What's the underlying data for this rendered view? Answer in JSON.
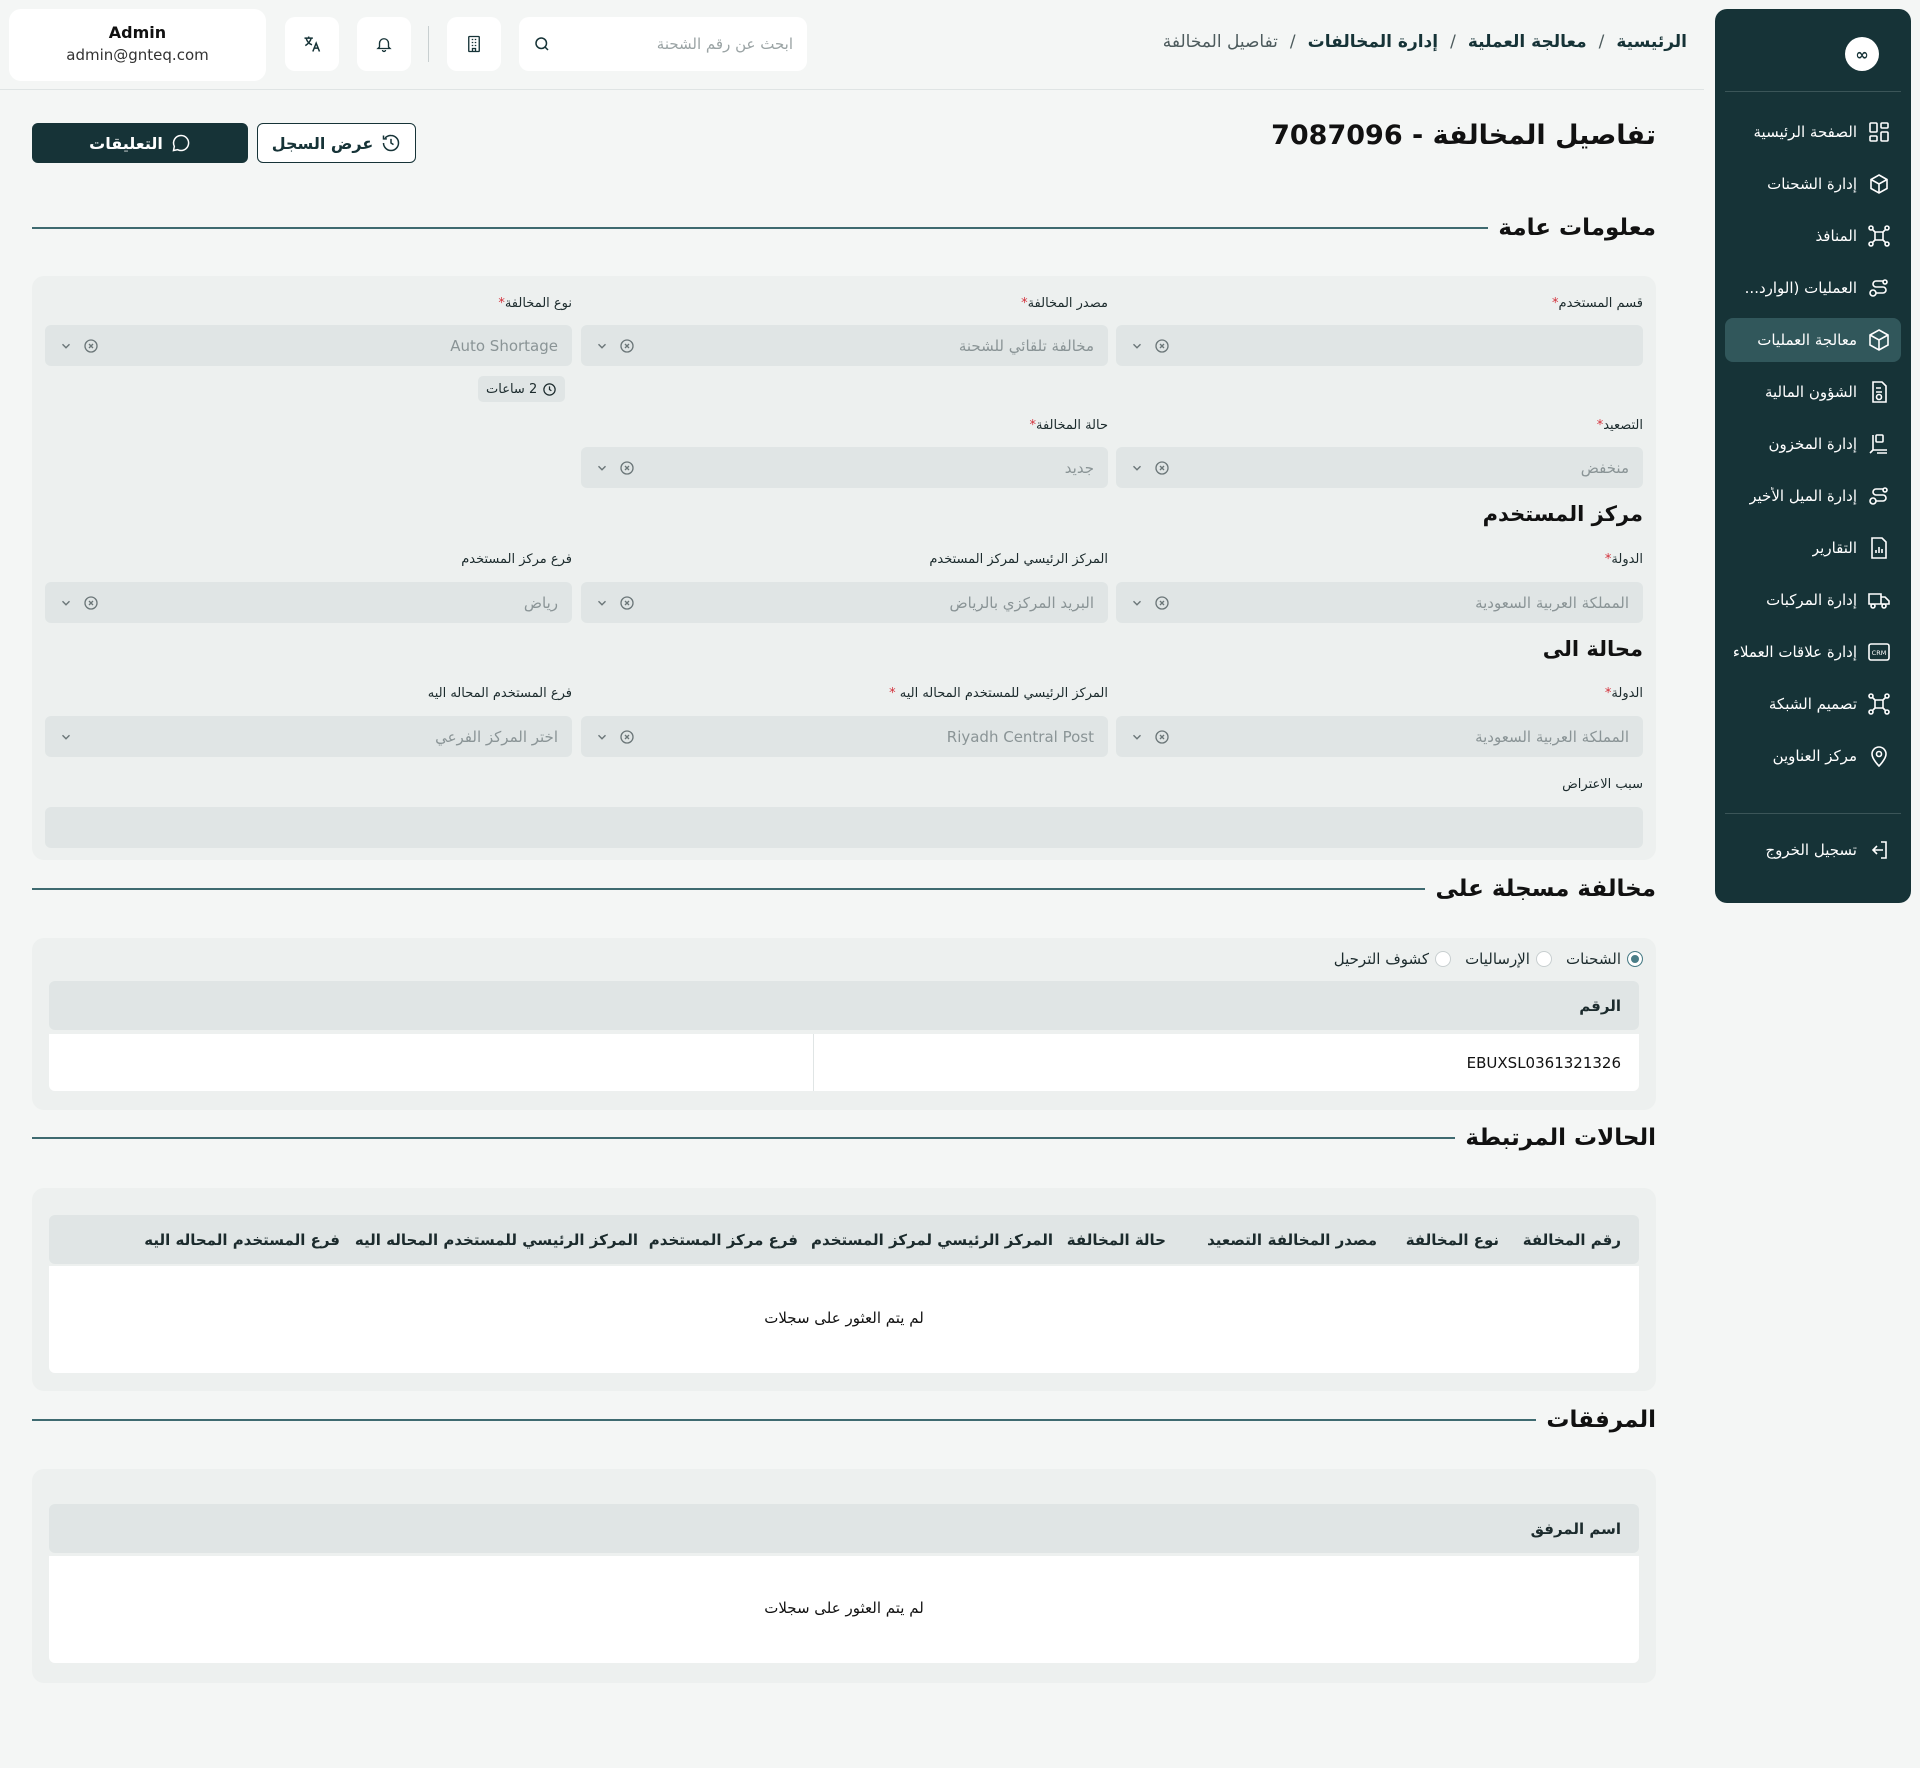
{
  "sidebar": {
    "logo": "∞",
    "items": [
      {
        "label": "الصفحة الرئيسية",
        "icon": "dashboard-icon"
      },
      {
        "label": "إدارة الشحنات",
        "icon": "package-icon"
      },
      {
        "label": "المنافذ",
        "icon": "network-icon"
      },
      {
        "label": "العمليات (الوارد...",
        "icon": "route-icon"
      },
      {
        "label": "معالجة العمليات",
        "icon": "box-icon",
        "active": true
      },
      {
        "label": "الشؤون المالية",
        "icon": "invoice-icon"
      },
      {
        "label": "إدارة المخزون",
        "icon": "inventory-icon"
      },
      {
        "label": "إدارة الميل الأخير",
        "icon": "route-icon"
      },
      {
        "label": "التقارير",
        "icon": "report-icon"
      },
      {
        "label": "إدارة المركبات",
        "icon": "truck-icon"
      },
      {
        "label": "إدارة علاقات العملاء",
        "icon": "crm-icon"
      },
      {
        "label": "تصميم الشبكة",
        "icon": "network-icon"
      },
      {
        "label": "مركز العناوين",
        "icon": "location-icon"
      }
    ],
    "logout": "تسجيل الخروج"
  },
  "header": {
    "breadcrumb": [
      "الرئيسية",
      "معالجة العملية",
      "إدارة المخالفات",
      "تفاصيل المخالفة"
    ],
    "search_placeholder": "ابحث عن رقم الشحنة",
    "user": {
      "name": "Admin",
      "email": "admin@gnteq.com"
    }
  },
  "page": {
    "title": "تفاصيل المخالفة - 7087096",
    "comments_button": "التعليقات",
    "history_button": "عرض السجل"
  },
  "general": {
    "title": "معلومات عامة",
    "user_dept": {
      "label": "قسم المستخدم",
      "value": ""
    },
    "source": {
      "label": "مصدر المخالفة",
      "value": "مخالفة تلقائي للشحنة"
    },
    "type": {
      "label": "نوع المخالفة",
      "value": "Auto Shortage"
    },
    "time_badge": "2 ساعات",
    "escalation": {
      "label": "التصعيد",
      "value": "منخفض"
    },
    "status": {
      "label": "حالة المخالفة",
      "value": "جديد"
    },
    "user_center_title": "مركز المستخدم",
    "country": {
      "label": "الدولة",
      "value": "المملكة العربية السعودية"
    },
    "main_center": {
      "label": "المركز الرئيسي لمركز المستخدم",
      "value": "البريد المركزي بالرياض"
    },
    "branch": {
      "label": "فرع مركز المستخدم",
      "value": "رياض"
    },
    "referred_title": "محالة الى",
    "ref_country": {
      "label": "الدولة",
      "value": "المملكة العربية السعودية"
    },
    "ref_main": {
      "label": "المركز الرئيسي للمستخدم المحاله اليه",
      "value": "Riyadh Central Post"
    },
    "ref_branch": {
      "label": "فرع المستخدم المحاله اليه",
      "value": "اختر المركز الفرعي"
    },
    "objection": {
      "label": "سبب الاعتراض",
      "value": ""
    }
  },
  "registered": {
    "title": "مخالفة مسجلة على",
    "options": [
      {
        "label": "الشحنات",
        "selected": true
      },
      {
        "label": "الإرساليات",
        "selected": false
      },
      {
        "label": "كشوف الترحيل",
        "selected": false
      }
    ],
    "column": "الرقم",
    "value": "EBUXSL0361321326"
  },
  "related": {
    "title": "الحالات المرتبطة",
    "columns": [
      "رقم المخالفة",
      "نوع المخالفة",
      "مصدر المخالفة",
      "التصعيد",
      "حالة المخالفة",
      "المركز الرئيسي لمركز المستخدم",
      "فرع مركز المستخدم",
      "المركز الرئيسي للمستخدم المحاله اليه",
      "فرع المستخدم المحاله اليه"
    ],
    "empty": "لم يتم العثور على سجلات"
  },
  "attachments": {
    "title": "المرفقات",
    "column": "اسم المرفق",
    "empty": "لم يتم العثور على سجلات"
  }
}
